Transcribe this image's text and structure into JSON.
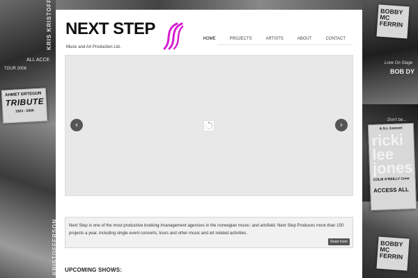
{
  "background": {
    "collage_texts": {
      "tribute_top": "AHMET ERTEGUN",
      "tribute_main": "TRIBUTE",
      "tribute_years": "1923 - 2006",
      "tour": "TOUR 2006",
      "all_access": "ALL ACCE",
      "kris_top": "KRIS KRISTOFFERSON",
      "kris_bottom": "KRISTOFFERSON",
      "bobby_top": "BOBBY MC FERRIN",
      "love": "Love On Stage",
      "bob_dylan": "BOB DY",
      "dont": "Don't be...",
      "ricki_small": "A.S.L Concert",
      "ricki_big": "ricki lee jones",
      "ricki_crew": "COLM O'REILLY Crew",
      "access_all": "ACCESS ALL",
      "bobby_bottom": "BOBBY MC FERRIN"
    }
  },
  "logo": {
    "title": "NEXT STEP",
    "subtitle": "Music and Art Production Ltd.",
    "mark_icon": "swoosh-logo",
    "mark_color": "#d81bd0"
  },
  "nav": {
    "items": [
      "HOME",
      "PROJECTS",
      "ARTISTS",
      "ABOUT",
      "CONTACT"
    ],
    "active_index": 0
  },
  "slider": {
    "prev_icon": "chevron-left-icon",
    "next_icon": "chevron-right-icon",
    "prev_glyph": "‹",
    "next_glyph": "›",
    "loading_icon": "spinner-icon"
  },
  "intro": {
    "text": "Next Step is one of the most productive booking-/management agencies in the norwegian music- and artsfield. Next Step Produces more than 150 projects a year, including single event concerts, tours and other music and art related activities.",
    "read_more": "Read more"
  },
  "upcoming": {
    "heading": "UPCOMING SHOWS:"
  },
  "colors": {
    "accent": "#d81bd0",
    "button": "#555555",
    "intro_bg": "#f1f1f1"
  }
}
